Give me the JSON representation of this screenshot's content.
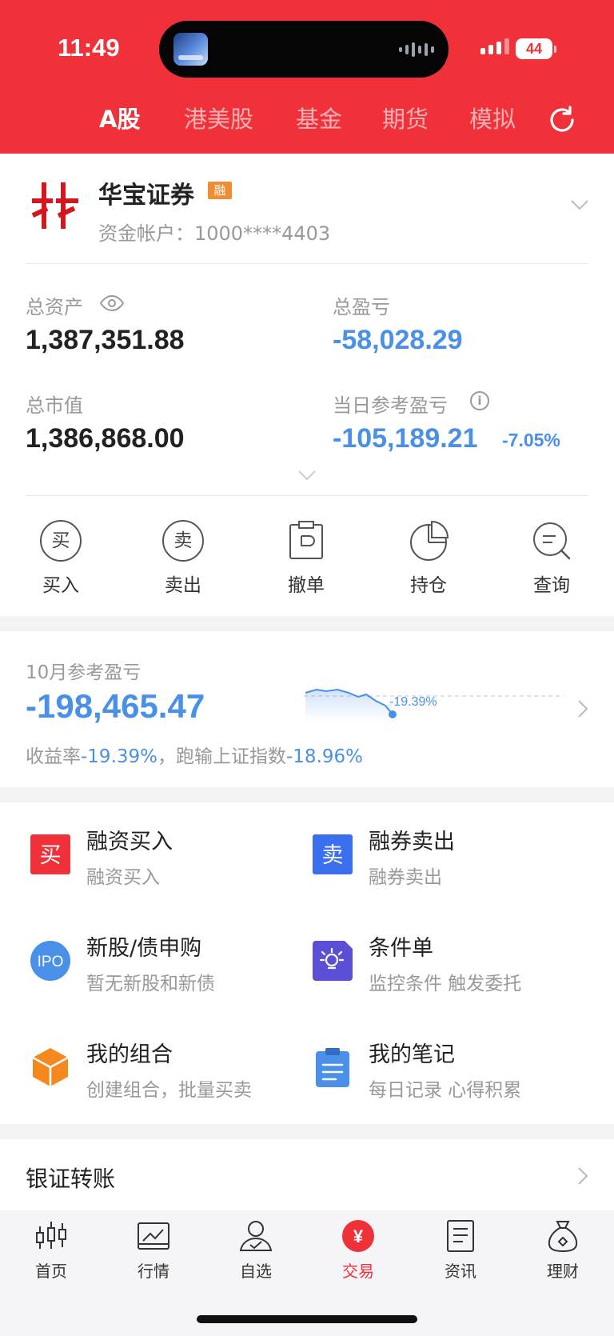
{
  "status_bar": {
    "time": "11:49",
    "battery": "44"
  },
  "top_tabs": [
    {
      "label": "A股",
      "active": true
    },
    {
      "label": "港美股",
      "active": false
    },
    {
      "label": "基金",
      "active": false
    },
    {
      "label": "期货",
      "active": false
    },
    {
      "label": "模拟",
      "active": false
    }
  ],
  "account": {
    "broker": "华宝证券",
    "badge": "融",
    "account_label": "资金帐户：1000****4403"
  },
  "summary": {
    "total_assets_label": "总资产",
    "total_assets_value": "1,387,351.88",
    "total_pnl_label": "总盈亏",
    "total_pnl_value": "-58,028.29",
    "market_value_label": "总市值",
    "market_value_value": "1,386,868.00",
    "daily_pnl_label": "当日参考盈亏",
    "daily_pnl_value": "-105,189.21",
    "daily_pnl_pct": "-7.05%"
  },
  "actions": [
    {
      "label": "买入",
      "glyph": "买"
    },
    {
      "label": "卖出",
      "glyph": "卖"
    },
    {
      "label": "撤单"
    },
    {
      "label": "持仓"
    },
    {
      "label": "查询"
    }
  ],
  "monthly": {
    "title": "10月参考盈亏",
    "value": "-198,465.47",
    "return_label": "收益率",
    "return_value": "-19.39%",
    "compare_label": "，跑输上证指数",
    "compare_value": "-18.96%",
    "spark_label": "-19.39%"
  },
  "services": [
    {
      "title": "融资买入",
      "subtitle": "融资买入",
      "icon": "buy-square-icon",
      "glyph": "买",
      "color": "#f0313a"
    },
    {
      "title": "融券卖出",
      "subtitle": "融券卖出",
      "icon": "sell-square-icon",
      "glyph": "卖",
      "color": "#3a6ff0"
    },
    {
      "title": "新股/债申购",
      "subtitle": "暂无新股和新债",
      "icon": "ipo-icon",
      "glyph": "IPO",
      "color": "#4a8fe8"
    },
    {
      "title": "条件单",
      "subtitle": "监控条件 触发委托",
      "icon": "condition-order-icon",
      "color": "#5b4fd8"
    },
    {
      "title": "我的组合",
      "subtitle": "创建组合，批量买卖",
      "icon": "portfolio-cube-icon",
      "color": "#f5891f"
    },
    {
      "title": "我的笔记",
      "subtitle": "每日记录 心得积累",
      "icon": "notes-clipboard-icon",
      "color": "#4a8fe8"
    }
  ],
  "bank_transfer": {
    "label": "银证转账"
  },
  "bottom_nav": [
    {
      "label": "首页",
      "active": false
    },
    {
      "label": "行情",
      "active": false
    },
    {
      "label": "自选",
      "active": false
    },
    {
      "label": "交易",
      "active": true,
      "glyph": "¥"
    },
    {
      "label": "资讯",
      "active": false
    },
    {
      "label": "理财",
      "active": false
    }
  ],
  "colors": {
    "brand_red": "#f0313a",
    "loss_blue": "#4a8fe8",
    "badge_orange": "#f08c31"
  }
}
